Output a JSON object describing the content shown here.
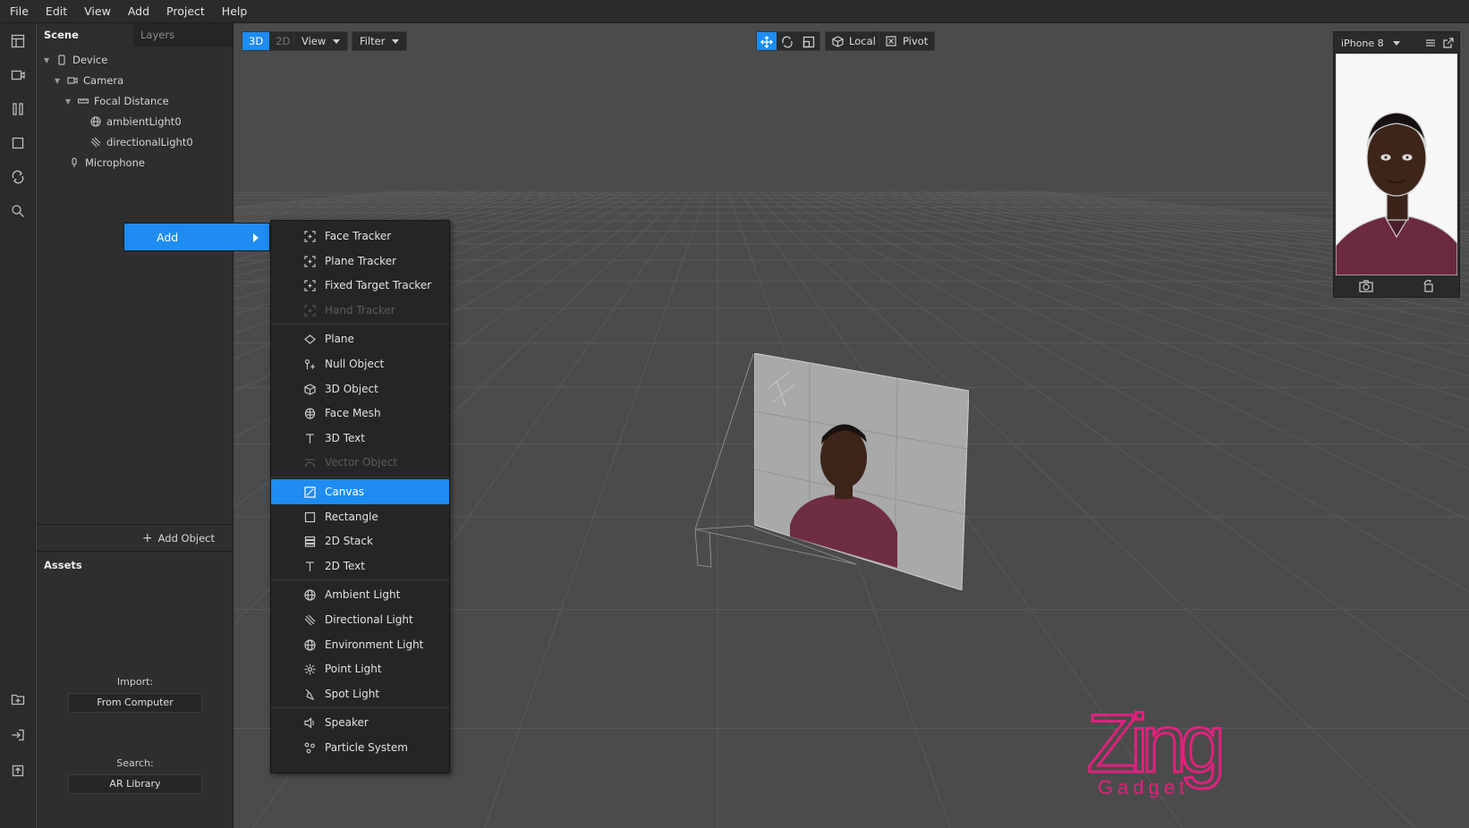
{
  "menubar": [
    "File",
    "Edit",
    "View",
    "Add",
    "Project",
    "Help"
  ],
  "rail_icons": [
    "layout-icon",
    "camera-icon",
    "columns-icon",
    "square-icon",
    "sync-icon",
    "search-icon",
    "add-folder-icon",
    "import-icon",
    "upload-icon"
  ],
  "scene": {
    "tabs": [
      "Scene",
      "Layers"
    ],
    "tree": [
      {
        "label": "Device",
        "icon": "device-icon"
      },
      {
        "label": "Camera",
        "icon": "camera-icon"
      },
      {
        "label": "Focal Distance",
        "icon": "ruler-icon"
      },
      {
        "label": "ambientLight0",
        "icon": "globe-icon"
      },
      {
        "label": "directionalLight0",
        "icon": "directional-light-icon"
      },
      {
        "label": "Microphone",
        "icon": "microphone-icon"
      }
    ],
    "add_object": "Add Object"
  },
  "assets": {
    "title": "Assets",
    "import_label": "Import:",
    "import_button": "From Computer",
    "search_label": "Search:",
    "search_button": "AR Library"
  },
  "viewport_toolbar": {
    "mode_3d": "3D",
    "mode_2d": "2D",
    "view": "View",
    "filter": "Filter",
    "local": "Local",
    "pivot": "Pivot"
  },
  "phone": {
    "device": "iPhone 8"
  },
  "context_menu": {
    "add": "Add",
    "groups": [
      [
        {
          "label": "Face Tracker",
          "icon": "tracker-icon",
          "enabled": true
        },
        {
          "label": "Plane Tracker",
          "icon": "tracker-icon",
          "enabled": true
        },
        {
          "label": "Fixed Target Tracker",
          "icon": "tracker-icon",
          "enabled": true
        },
        {
          "label": "Hand Tracker",
          "icon": "tracker-icon",
          "enabled": false
        }
      ],
      [
        {
          "label": "Plane",
          "icon": "plane-icon",
          "enabled": true
        },
        {
          "label": "Null Object",
          "icon": "null-object-icon",
          "enabled": true
        },
        {
          "label": "3D Object",
          "icon": "cube-icon",
          "enabled": true
        },
        {
          "label": "Face Mesh",
          "icon": "face-mesh-icon",
          "enabled": true
        },
        {
          "label": "3D Text",
          "icon": "text-icon",
          "enabled": true
        },
        {
          "label": "Vector Object",
          "icon": "vector-icon",
          "enabled": false
        }
      ],
      [
        {
          "label": "Canvas",
          "icon": "canvas-icon",
          "enabled": true,
          "highlighted": true
        },
        {
          "label": "Rectangle",
          "icon": "rectangle-icon",
          "enabled": true
        },
        {
          "label": "2D Stack",
          "icon": "stack-icon",
          "enabled": true
        },
        {
          "label": "2D Text",
          "icon": "text-icon",
          "enabled": true
        }
      ],
      [
        {
          "label": "Ambient Light",
          "icon": "globe-icon",
          "enabled": true
        },
        {
          "label": "Directional Light",
          "icon": "directional-light-icon",
          "enabled": true
        },
        {
          "label": "Environment Light",
          "icon": "globe-icon",
          "enabled": true
        },
        {
          "label": "Point Light",
          "icon": "point-light-icon",
          "enabled": true
        },
        {
          "label": "Spot Light",
          "icon": "spot-light-icon",
          "enabled": true
        }
      ],
      [
        {
          "label": "Speaker",
          "icon": "speaker-icon",
          "enabled": true
        },
        {
          "label": "Particle System",
          "icon": "particle-icon",
          "enabled": true
        }
      ]
    ]
  },
  "logo": {
    "main": "Zing",
    "sub": "Gadget",
    "color": "#e0217e"
  },
  "colors": {
    "accent": "#1e8cf0"
  }
}
